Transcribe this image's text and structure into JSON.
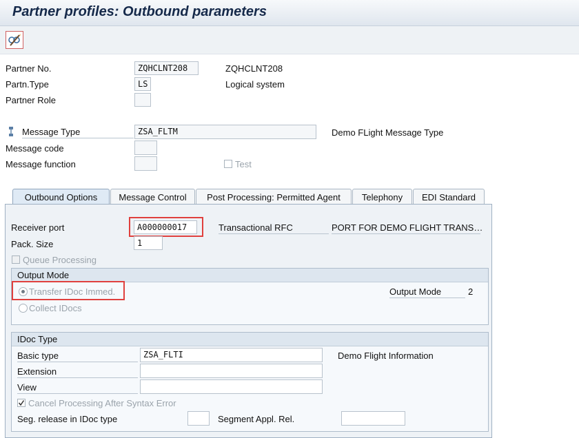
{
  "title": "Partner profiles: Outbound parameters",
  "toolbar": {
    "icon": "display-change-icon"
  },
  "header": {
    "partner_no_label": "Partner No.",
    "partner_no_value": "ZQHCLNT208",
    "partner_no_text": "ZQHCLNT208",
    "partn_type_label": "Partn.Type",
    "partn_type_value": "LS",
    "partn_type_text": "Logical system",
    "partner_role_label": "Partner Role",
    "partner_role_value": ""
  },
  "message": {
    "type_label": "Message Type",
    "type_value": "ZSA_FLTM",
    "type_text": "Demo FLight Message Type",
    "code_label": "Message code",
    "code_value": "",
    "function_label": "Message function",
    "function_value": "",
    "test_label": "Test"
  },
  "tabs": [
    {
      "label": "Outbound Options"
    },
    {
      "label": "Message Control"
    },
    {
      "label": "Post Processing: Permitted Agent"
    },
    {
      "label": "Telephony"
    },
    {
      "label": "EDI Standard"
    }
  ],
  "outbound": {
    "receiver_port_label": "Receiver port",
    "receiver_port_value": "A000000017",
    "port_type": "Transactional RFC",
    "port_description": "PORT FOR DEMO FLIGHT TRANS…",
    "pack_size_label": "Pack. Size",
    "pack_size_value": "1",
    "queue_processing_label": "Queue Processing"
  },
  "output_mode": {
    "header": "Output Mode",
    "transfer_label": "Transfer IDoc Immed.",
    "collect_label": "Collect IDocs",
    "output_mode_label": "Output Mode",
    "output_mode_value": "2"
  },
  "idoc_type": {
    "header": "IDoc Type",
    "basic_type_label": "Basic type",
    "basic_type_value": "ZSA_FLTI",
    "basic_type_text": "Demo Flight Information",
    "extension_label": "Extension",
    "extension_value": "",
    "view_label": "View",
    "view_value": "",
    "cancel_label": "Cancel Processing After Syntax Error",
    "seg_release_label": "Seg. release in IDoc type",
    "seg_release_value": "",
    "segment_appl_rel_label": "Segment Appl. Rel.",
    "segment_appl_rel_value": ""
  }
}
